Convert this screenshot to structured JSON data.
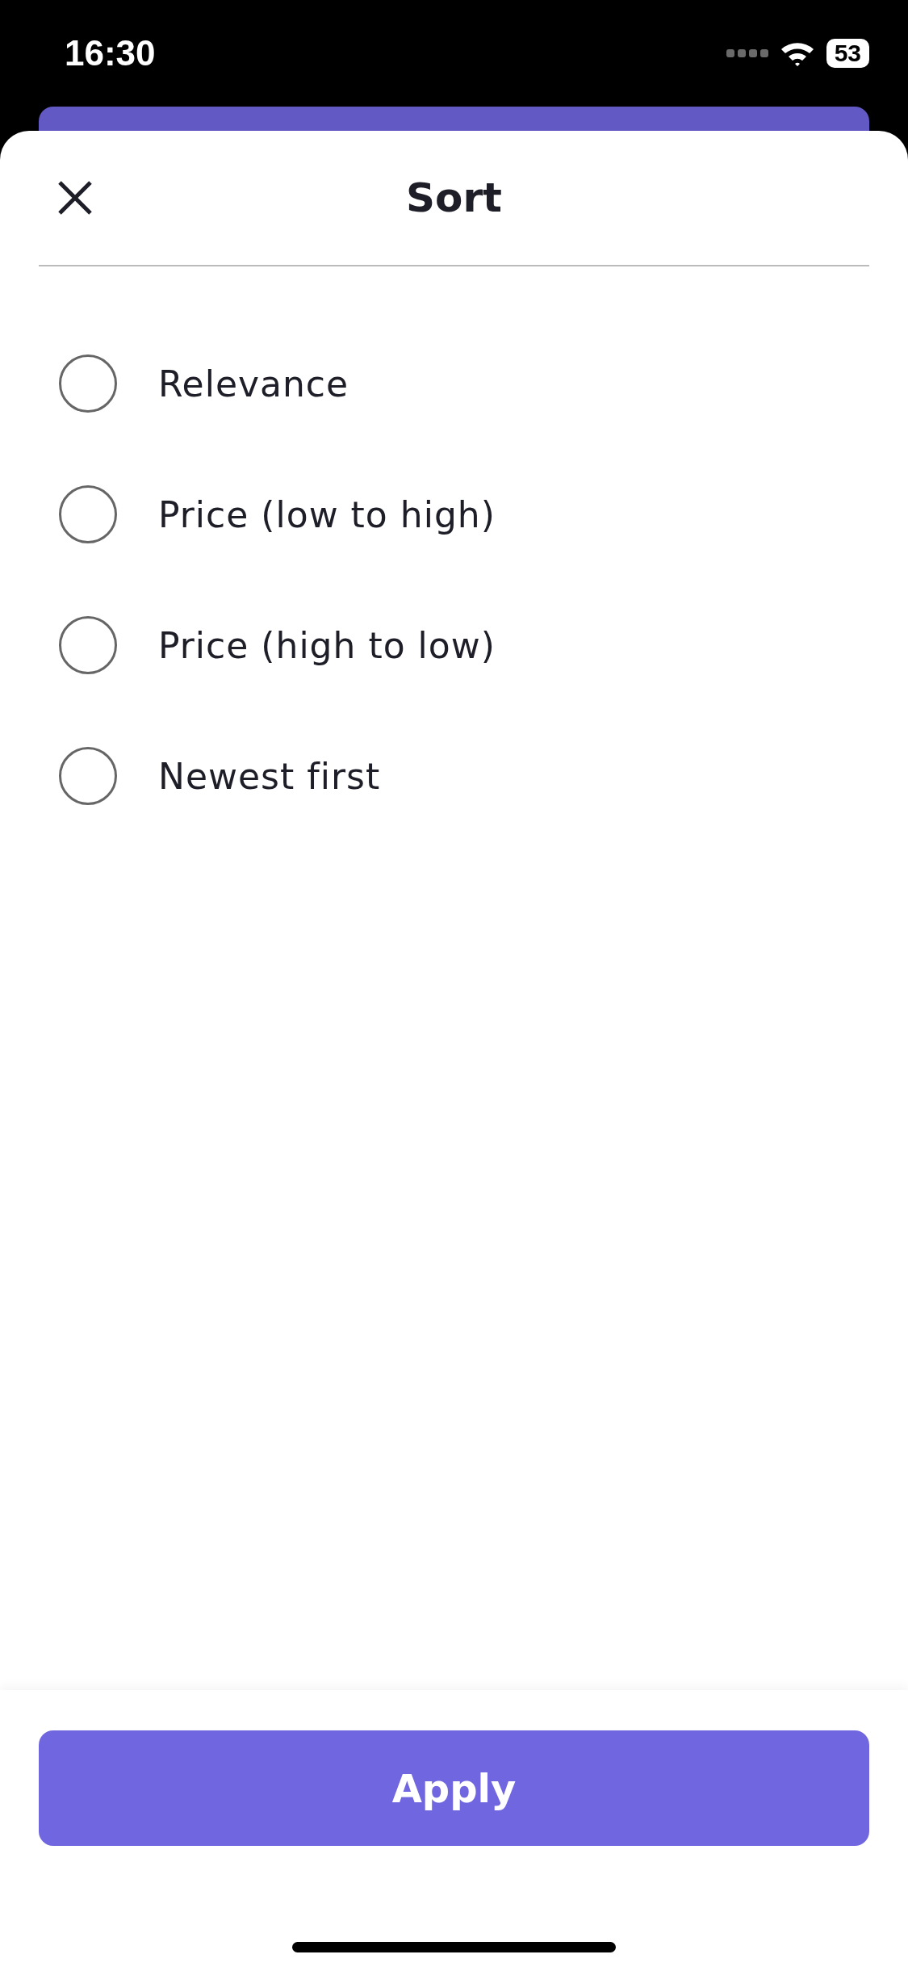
{
  "status_bar": {
    "time": "16:30",
    "battery": "53"
  },
  "header": {
    "title": "Sort"
  },
  "options": [
    {
      "label": "Relevance",
      "selected": false
    },
    {
      "label": "Price (low to high)",
      "selected": false
    },
    {
      "label": "Price (high to low)",
      "selected": false
    },
    {
      "label": "Newest first",
      "selected": false
    }
  ],
  "apply_button": {
    "label": "Apply"
  }
}
